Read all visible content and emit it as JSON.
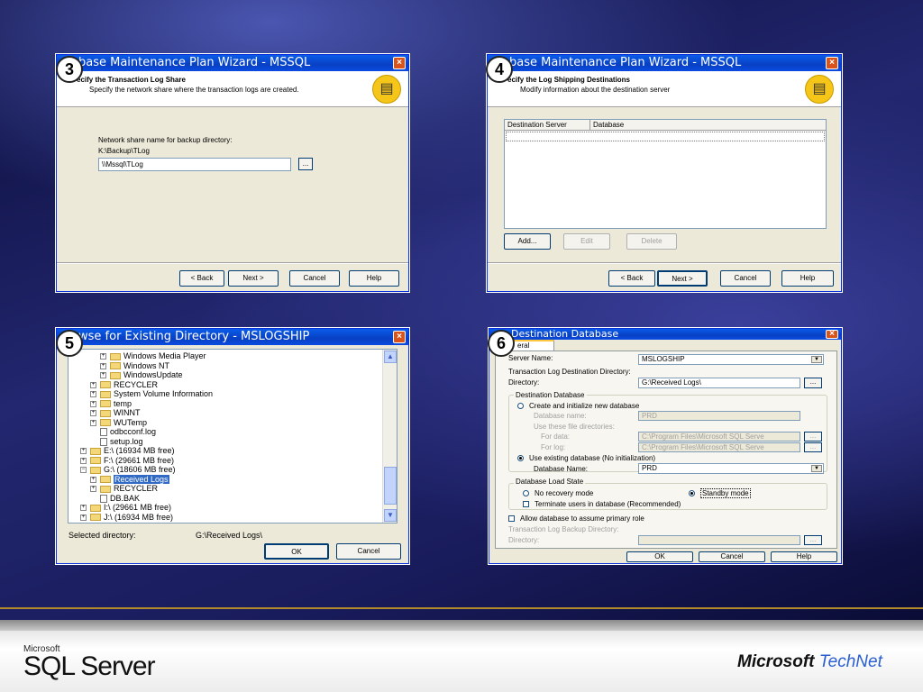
{
  "panels": {
    "p3": {
      "badge": "3",
      "title": "base Maintenance Plan Wizard - MSSQL",
      "close": "×",
      "header_title": "ecify the Transaction Log Share",
      "header_subtitle": "Specify the network share where the transaction logs are created.",
      "share_label": "Network share name for backup directory:",
      "share_hint": "K:\\Backup\\TLog",
      "share_value": "\\\\Mssql\\TLog",
      "browse": "...",
      "back": "< Back",
      "next": "Next >",
      "cancel": "Cancel",
      "help": "Help"
    },
    "p4": {
      "badge": "4",
      "title": "base Maintenance Plan Wizard - MSSQL",
      "close": "×",
      "header_title": "ecify the Log Shipping Destinations",
      "header_subtitle": "Modify information about the destination server",
      "col_server": "Destination Server",
      "col_database": "Database",
      "add": "Add...",
      "edit": "Edit",
      "delete": "Delete",
      "back": "< Back",
      "next": "Next >",
      "cancel": "Cancel",
      "help": "Help"
    },
    "p5": {
      "badge": "5",
      "title": "wse for Existing Directory - MSLOGSHIP",
      "close": "×",
      "tree": [
        {
          "label": "Windows Media Player",
          "depth": 3,
          "kind": "folder",
          "pm": "+"
        },
        {
          "label": "Windows NT",
          "depth": 3,
          "kind": "folder",
          "pm": "+"
        },
        {
          "label": "WindowsUpdate",
          "depth": 3,
          "kind": "folder",
          "pm": "+"
        },
        {
          "label": "RECYCLER",
          "depth": 2,
          "kind": "folder",
          "pm": "+"
        },
        {
          "label": "System Volume Information",
          "depth": 2,
          "kind": "folder",
          "pm": "+"
        },
        {
          "label": "temp",
          "depth": 2,
          "kind": "folder",
          "pm": "+"
        },
        {
          "label": "WINNT",
          "depth": 2,
          "kind": "folder",
          "pm": "+"
        },
        {
          "label": "WUTemp",
          "depth": 2,
          "kind": "folder",
          "pm": "+"
        },
        {
          "label": "odbcconf.log",
          "depth": 2,
          "kind": "file",
          "pm": ""
        },
        {
          "label": "setup.log",
          "depth": 2,
          "kind": "file",
          "pm": ""
        },
        {
          "label": "E:\\ (16934 MB free)",
          "depth": 1,
          "kind": "folder",
          "pm": "+"
        },
        {
          "label": "F:\\ (29661 MB free)",
          "depth": 1,
          "kind": "folder",
          "pm": "+"
        },
        {
          "label": "G:\\ (18606 MB free)",
          "depth": 1,
          "kind": "folder",
          "pm": "−"
        },
        {
          "label": "Received Logs",
          "depth": 2,
          "kind": "folder",
          "pm": "+",
          "selected": true
        },
        {
          "label": "RECYCLER",
          "depth": 2,
          "kind": "folder",
          "pm": "+"
        },
        {
          "label": "DB.BAK",
          "depth": 2,
          "kind": "file",
          "pm": ""
        },
        {
          "label": "I:\\ (29661 MB free)",
          "depth": 1,
          "kind": "folder",
          "pm": "+"
        },
        {
          "label": "J:\\ (16934 MB free)",
          "depth": 1,
          "kind": "folder",
          "pm": "+"
        }
      ],
      "selected_label": "Selected directory:",
      "selected_value": "G:\\Received Logs\\",
      "ok": "OK",
      "cancel": "Cancel"
    },
    "p6": {
      "badge": "6",
      "title": "Destination Database",
      "close": "×",
      "tab": "eral",
      "server_label": "Server Name:",
      "server_value": "MSLOGSHIP",
      "tlog_dir_label": "Transaction Log Destination Directory:",
      "dir_label": "Directory:",
      "dir_value": "G:\\Received Logs\\",
      "dest_db_group": "Destination Database",
      "create_new": "Create and initialize new database",
      "db_name_label_dis": "Database name:",
      "db_name_value_dis": "PRD",
      "use_file_dirs": "Use these file directories:",
      "for_data": "For data:",
      "for_data_value": "C:\\Program Files\\Microsoft SQL Serve",
      "for_log": "For log:",
      "for_log_value": "C:\\Program Files\\Microsoft SQL Serve",
      "use_existing": "Use existing database (No initialization)",
      "db_name_label": "Database Name:",
      "db_name_value": "PRD",
      "load_state_group": "Database Load State",
      "no_recovery": "No recovery mode",
      "standby": "Standby mode",
      "terminate": "Terminate users in database (Recommended)",
      "allow_primary": "Allow database to assume primary role",
      "tlog_backup_dir": "Transaction Log Backup Directory:",
      "directory_dis": "Directory:",
      "ok": "OK",
      "cancel": "Cancel",
      "help": "Help"
    }
  },
  "footer": {
    "sql_ms": "Microsoft",
    "sql_product": "SQL Server",
    "technet_ms": "Microsoft",
    "technet_tn": "TechNet"
  }
}
